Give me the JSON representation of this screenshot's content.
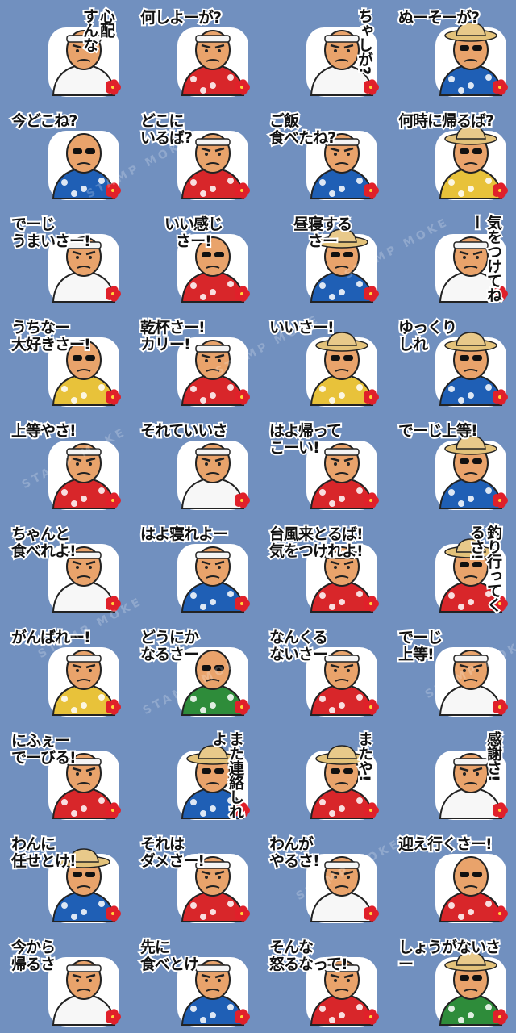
{
  "watermark": "STAMP MOKE",
  "colors": {
    "background": "#7190bf",
    "skin": "#e9a36b",
    "headband": "#f4f4f4",
    "shirt_red": "#d8262a",
    "shirt_blue": "#1f5fb5",
    "shirt_yellow": "#e8c23a",
    "shirt_green": "#2e8c3a",
    "hibiscus": "#e0202a"
  },
  "stickers": [
    {
      "caption": "心配\nすんな",
      "shirt": "white",
      "hat": "headband",
      "style": "vert"
    },
    {
      "caption": "何しよーが?",
      "shirt": "red",
      "hat": "headband",
      "style": ""
    },
    {
      "caption": "ちゃしが?",
      "shirt": "white",
      "hat": "headband",
      "style": "vert"
    },
    {
      "caption": "ぬーそーが?",
      "shirt": "blue",
      "hat": "straw",
      "style": ""
    },
    {
      "caption": "今どこね?",
      "shirt": "blue",
      "hat": "sunglasses",
      "style": ""
    },
    {
      "caption": "どこに\nいるば?",
      "shirt": "red",
      "hat": "headband",
      "style": ""
    },
    {
      "caption": "ご飯\n食べたね?",
      "shirt": "blue",
      "hat": "headband",
      "style": ""
    },
    {
      "caption": "何時に帰るば?",
      "shirt": "yellow",
      "hat": "straw",
      "style": ""
    },
    {
      "caption": "でーじ\nうまいさー!",
      "shirt": "white",
      "hat": "headband",
      "style": ""
    },
    {
      "caption": "いい感じさー!",
      "shirt": "red",
      "hat": "sunglasses",
      "style": "center"
    },
    {
      "caption": "昼寝するさー",
      "shirt": "blue",
      "hat": "straw",
      "style": "center"
    },
    {
      "caption": "気をつけてねー",
      "shirt": "white",
      "hat": "headband",
      "style": "vert"
    },
    {
      "caption": "うちなー\n大好きさー!",
      "shirt": "yellow",
      "hat": "sunglasses",
      "style": ""
    },
    {
      "caption": "乾杯さー!\nカリー!",
      "shirt": "red",
      "hat": "headband",
      "style": ""
    },
    {
      "caption": "いいさー!",
      "shirt": "yellow",
      "hat": "straw",
      "style": ""
    },
    {
      "caption": "ゆっくり\nしれ",
      "shirt": "blue",
      "hat": "straw",
      "style": ""
    },
    {
      "caption": "上等やさ!",
      "shirt": "red",
      "hat": "headband",
      "style": ""
    },
    {
      "caption": "それていいさ",
      "shirt": "white",
      "hat": "headband",
      "style": ""
    },
    {
      "caption": "はよ帰って\nこーい!",
      "shirt": "red",
      "hat": "headband",
      "style": ""
    },
    {
      "caption": "でーじ上等!",
      "shirt": "blue",
      "hat": "straw",
      "style": ""
    },
    {
      "caption": "ちゃんと\n食べれよ!",
      "shirt": "white",
      "hat": "headband",
      "style": ""
    },
    {
      "caption": "はよ寝れよー",
      "shirt": "blue",
      "hat": "headband",
      "style": ""
    },
    {
      "caption": "台風来とるば!\n気をつけれよ!",
      "shirt": "red",
      "hat": "headband",
      "style": ""
    },
    {
      "caption": "釣り行ってくるさ!",
      "shirt": "red",
      "hat": "straw",
      "style": "vert"
    },
    {
      "caption": "がんばれー!",
      "shirt": "yellow",
      "hat": "headband",
      "style": ""
    },
    {
      "caption": "どうにか\nなるさー",
      "shirt": "green",
      "hat": "sunglasses",
      "style": ""
    },
    {
      "caption": "なんくる\nないさー",
      "shirt": "red",
      "hat": "headband",
      "style": ""
    },
    {
      "caption": "でーじ\n上等!",
      "shirt": "white",
      "hat": "headband",
      "style": ""
    },
    {
      "caption": "にふぇー\nでーびる!",
      "shirt": "red",
      "hat": "headband",
      "style": ""
    },
    {
      "caption": "また連絡しれよ",
      "shirt": "blue",
      "hat": "straw",
      "style": "vert"
    },
    {
      "caption": "またや!",
      "shirt": "red",
      "hat": "straw",
      "style": "vert"
    },
    {
      "caption": "感謝さ!",
      "shirt": "white",
      "hat": "headband",
      "style": "vert"
    },
    {
      "caption": "わんに\n任せとけ!",
      "shirt": "blue",
      "hat": "straw",
      "style": ""
    },
    {
      "caption": "それは\nダメさー!",
      "shirt": "red",
      "hat": "headband",
      "style": ""
    },
    {
      "caption": "わんが\nやるさ!",
      "shirt": "white",
      "hat": "headband",
      "style": ""
    },
    {
      "caption": "迎え行くさー!",
      "shirt": "red",
      "hat": "sunglasses",
      "style": ""
    },
    {
      "caption": "今から\n帰るさ",
      "shirt": "white",
      "hat": "headband",
      "style": ""
    },
    {
      "caption": "先に\n食べとけ",
      "shirt": "blue",
      "hat": "headband",
      "style": ""
    },
    {
      "caption": "そんな\n怒るなって!",
      "shirt": "red",
      "hat": "headband",
      "style": ""
    },
    {
      "caption": "しょうがないさー",
      "shirt": "green",
      "hat": "straw",
      "style": ""
    }
  ]
}
